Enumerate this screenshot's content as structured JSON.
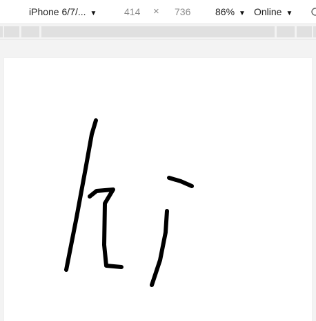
{
  "toolbar": {
    "device": {
      "label": "iPhone 6/7/...",
      "icon": "caret-down-icon"
    },
    "width": "414",
    "separator": "×",
    "height": "736",
    "zoom": {
      "label": "86%",
      "icon": "caret-down-icon"
    },
    "throttle": {
      "label": "Online",
      "icon": "caret-down-icon"
    },
    "rotate_icon": "rotate-icon"
  },
  "canvas": {
    "background": "#ffffff",
    "stroke_color": "#000000",
    "content_description_icon": "drawing-canvas"
  }
}
